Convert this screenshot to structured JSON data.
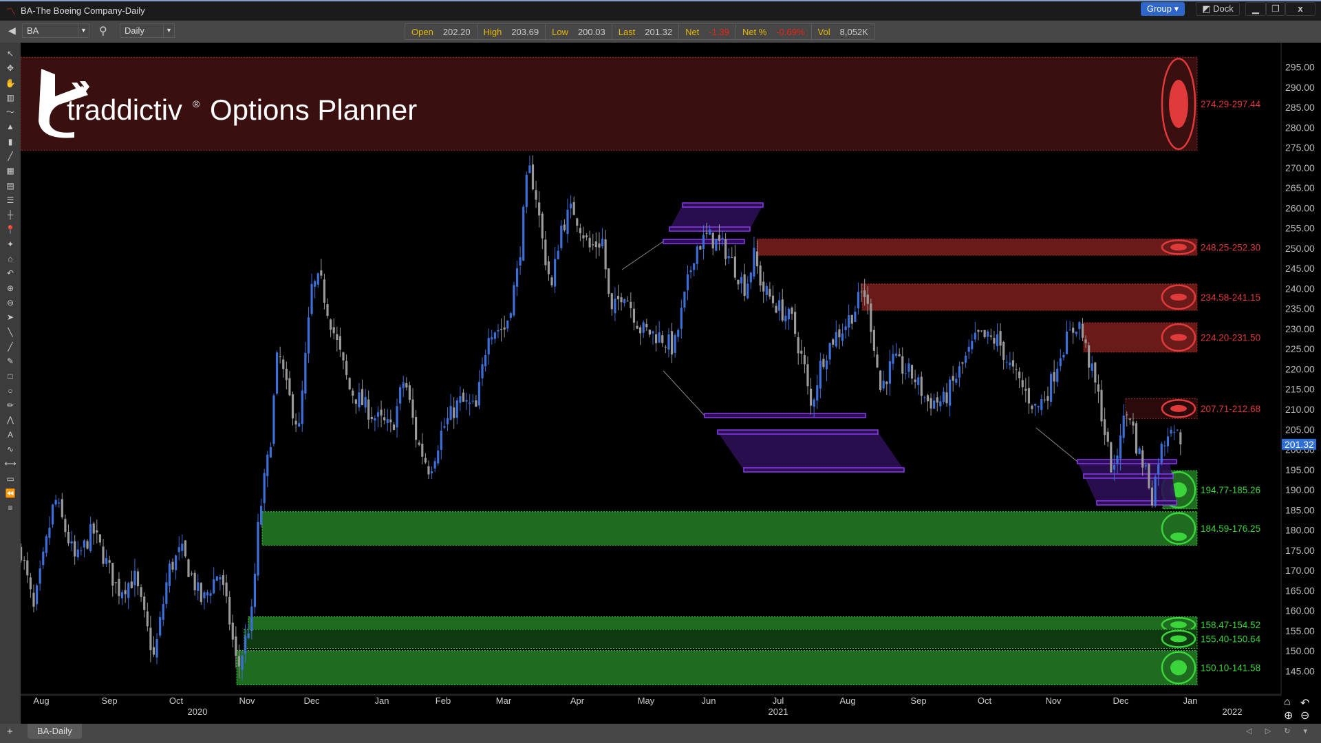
{
  "window": {
    "title": "BA-The Boeing Company-Daily",
    "group_label": "Group",
    "dock_label": "Dock",
    "minimize": "▁",
    "restore": "❐",
    "close": "x"
  },
  "toolbar": {
    "symbol": "BA",
    "interval": "Daily"
  },
  "quote": [
    {
      "label": "Open",
      "value": "202.20",
      "negative": false
    },
    {
      "label": "High",
      "value": "203.69",
      "negative": false
    },
    {
      "label": "Low",
      "value": "200.03",
      "negative": false
    },
    {
      "label": "Last",
      "value": "201.32",
      "negative": false
    },
    {
      "label": "Net",
      "value": "-1.39",
      "negative": true
    },
    {
      "label": "Net %",
      "value": "-0.69%",
      "negative": true
    },
    {
      "label": "Vol",
      "value": "8,052K",
      "negative": false
    }
  ],
  "logo": {
    "brand": "traddictiv",
    "registered": "®",
    "product": "Options Planner"
  },
  "price_axis": {
    "ticks": [
      "295.00",
      "290.00",
      "285.00",
      "280.00",
      "275.00",
      "270.00",
      "265.00",
      "260.00",
      "255.00",
      "250.00",
      "245.00",
      "240.00",
      "235.00",
      "230.00",
      "225.00",
      "220.00",
      "215.00",
      "210.00",
      "205.00",
      "200.00",
      "195.00",
      "190.00",
      "185.00",
      "180.00",
      "175.00",
      "170.00",
      "165.00",
      "160.00",
      "155.00",
      "150.00",
      "145.00"
    ],
    "last_price": "201.32",
    "last_price_color": "#2f6fd6"
  },
  "time_axis": {
    "months": [
      "Aug",
      "Sep",
      "Oct",
      "Nov",
      "Dec",
      "Jan",
      "Feb",
      "Mar",
      "Apr",
      "May",
      "Jun",
      "Jul",
      "Aug",
      "Sep",
      "Oct",
      "Nov",
      "Dec",
      "Jan"
    ],
    "years": [
      "2020",
      "2021",
      "2022"
    ]
  },
  "zones": [
    {
      "label": "274.29-297.44",
      "low": 274.29,
      "high": 297.44,
      "kind": "resistance"
    },
    {
      "label": "248.25-252.30",
      "low": 248.25,
      "high": 252.3,
      "kind": "resistance"
    },
    {
      "label": "234.58-241.15",
      "low": 234.58,
      "high": 241.15,
      "kind": "resistance"
    },
    {
      "label": "224.20-231.50",
      "low": 224.2,
      "high": 231.5,
      "kind": "resistance"
    },
    {
      "label": "207.71-212.68",
      "low": 207.71,
      "high": 212.68,
      "kind": "resistance"
    },
    {
      "label": "194.77-185.26",
      "low": 185.26,
      "high": 194.77,
      "kind": "support"
    },
    {
      "label": "184.59-176.25",
      "low": 176.25,
      "high": 184.59,
      "kind": "support"
    },
    {
      "label": "158.47-154.52",
      "low": 154.52,
      "high": 158.47,
      "kind": "support"
    },
    {
      "label": "155.40-150.64",
      "low": 150.64,
      "high": 155.4,
      "kind": "support"
    },
    {
      "label": "150.10-141.58",
      "low": 141.58,
      "high": 150.1,
      "kind": "support"
    }
  ],
  "colors": {
    "resistance": "#e03a3a",
    "support": "#3bd43b",
    "pattern": "#8a3cf0",
    "up_candle": "#3d6fd8",
    "down_candle": "#9a9a9a"
  },
  "left_tools": [
    "cursor-icon",
    "crosshair-icon",
    "hand-icon",
    "bar-icon",
    "line-chart-icon",
    "area-icon",
    "candle-icon",
    "trend-icon",
    "grid-icon",
    "table-icon",
    "list-icon",
    "horizontal-line-icon",
    "pin-icon",
    "marker-icon",
    "home-icon",
    "undo-icon",
    "zoom-in-icon",
    "zoom-out-icon",
    "pointer-icon",
    "line-tool-icon",
    "ray-icon",
    "pen-icon",
    "rectangle-icon",
    "circle-icon",
    "pencil-icon",
    "fib-icon",
    "text-icon",
    "path-icon",
    "measure-icon",
    "label-icon",
    "rewind-icon",
    "menu-icon"
  ],
  "bottom": {
    "tab": "BA-Daily",
    "add": "+",
    "nav": "◁ ▷ ↻ ▾"
  }
}
